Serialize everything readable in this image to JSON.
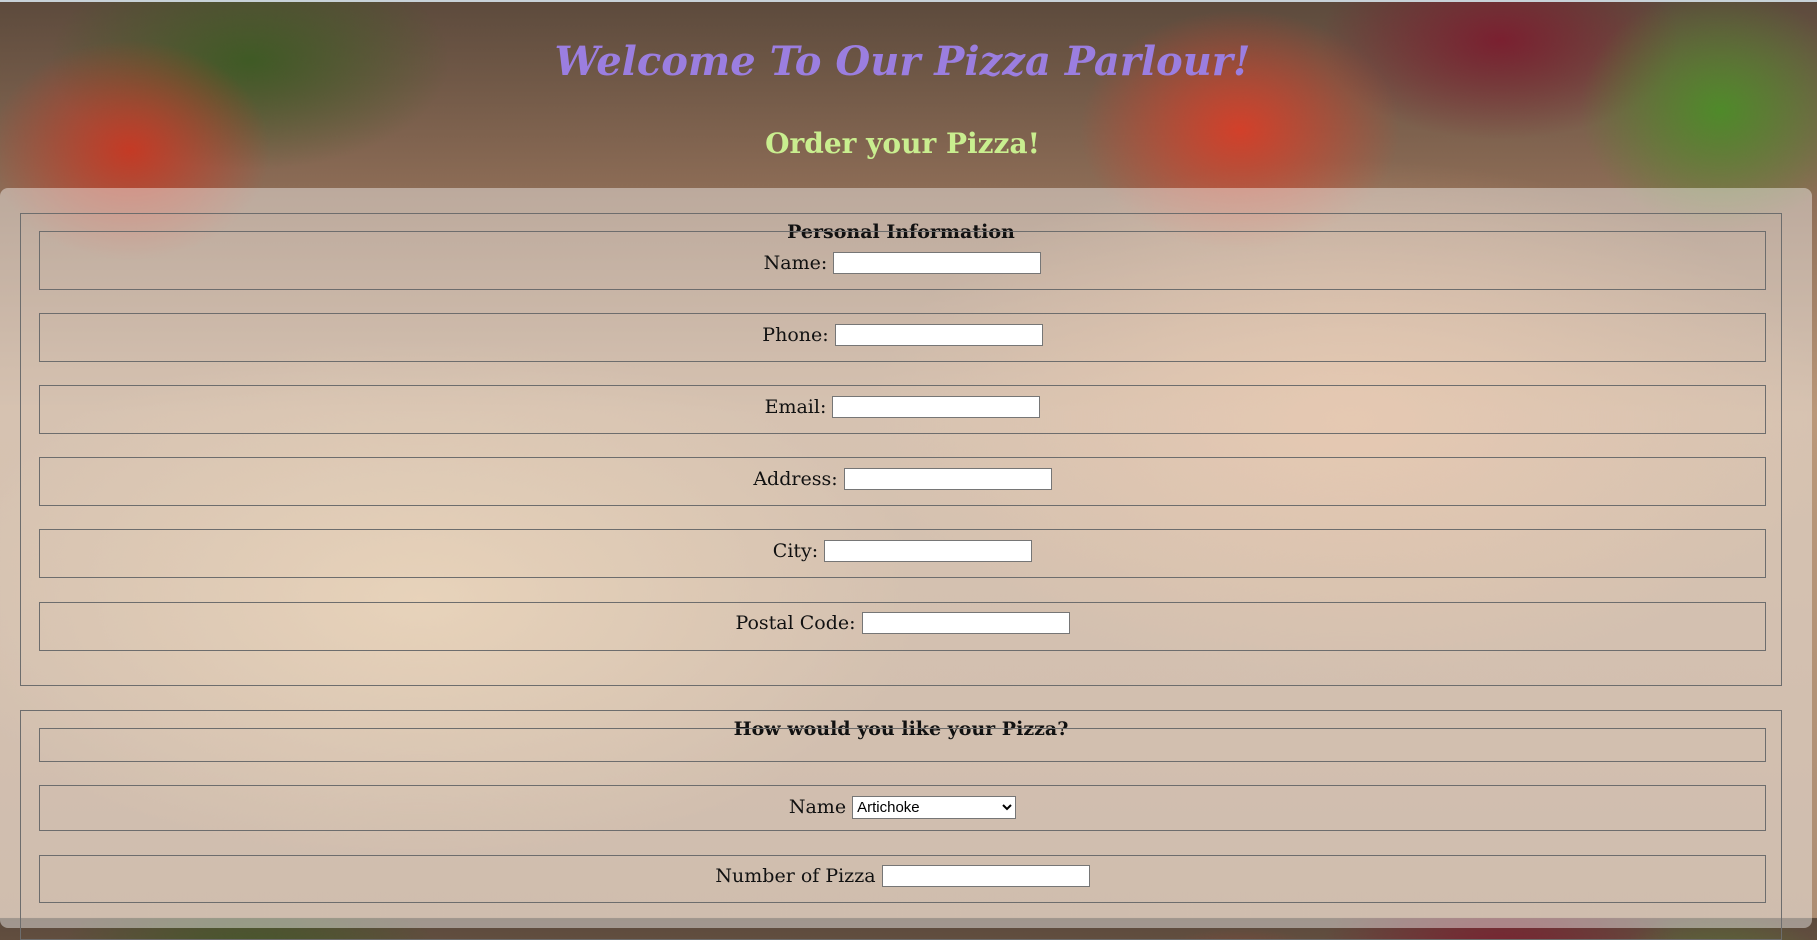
{
  "page": {
    "title": "Welcome To Our Pizza Parlour!",
    "subtitle": "Order your Pizza!"
  },
  "personal_info": {
    "legend": "Personal Information",
    "fields": {
      "name": {
        "label": "Name:",
        "value": ""
      },
      "phone": {
        "label": "Phone:",
        "value": ""
      },
      "email": {
        "label": "Email:",
        "value": ""
      },
      "address": {
        "label": "Address:",
        "value": ""
      },
      "city": {
        "label": "City:",
        "value": ""
      },
      "postal_code": {
        "label": "Postal Code:",
        "value": ""
      }
    }
  },
  "pizza_order": {
    "legend": "How would you like your Pizza?",
    "name_label": "Name",
    "name_selected": "Artichoke",
    "quantity_label": "Number of Pizza",
    "quantity_value": ""
  },
  "colors": {
    "title": "#9b7ee0",
    "subtitle": "#c9ee8f"
  }
}
